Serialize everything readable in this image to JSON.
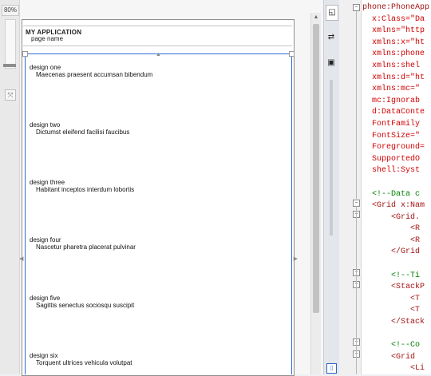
{
  "designer": {
    "zoom": "80%",
    "app_title": "MY APPLICATION",
    "page_name": "page name",
    "items": [
      {
        "title": "design one",
        "subtitle": "Maecenas praesent accumsan bibendum"
      },
      {
        "title": "design two",
        "subtitle": "Dictumst eleifend facilisi faucibus"
      },
      {
        "title": "design three",
        "subtitle": "Habitant inceptos interdum lobortis"
      },
      {
        "title": "design four",
        "subtitle": "Nascetur pharetra placerat pulvinar"
      },
      {
        "title": "design five",
        "subtitle": "Sagittis senectus sociosqu suscipit"
      },
      {
        "title": "design six",
        "subtitle": "Torquent ultrices vehicula volutpat"
      }
    ]
  },
  "xaml": {
    "lines": [
      [
        [
          "phone:PhoneApp",
          "c-tag"
        ]
      ],
      [
        [
          "  x:Class=\"Da",
          "c-attr"
        ]
      ],
      [
        [
          "  xmlns=\"http",
          "c-attr"
        ]
      ],
      [
        [
          "  xmlns:x=\"ht",
          "c-attr"
        ]
      ],
      [
        [
          "  xmlns:phone",
          "c-attr"
        ]
      ],
      [
        [
          "  xmlns:shel",
          "c-attr"
        ]
      ],
      [
        [
          "  xmlns:d=\"ht",
          "c-attr"
        ]
      ],
      [
        [
          "  xmlns:mc=\"",
          "c-attr"
        ]
      ],
      [
        [
          "  mc:Ignorab",
          "c-attr"
        ]
      ],
      [
        [
          "  d:DataConte",
          "c-attr"
        ]
      ],
      [
        [
          "  FontFamily",
          "c-attr"
        ]
      ],
      [
        [
          "  FontSize=\"",
          "c-attr"
        ]
      ],
      [
        [
          "  Foreground=",
          "c-attr"
        ]
      ],
      [
        [
          "  SupportedO",
          "c-attr"
        ]
      ],
      [
        [
          "  shell:Syst",
          "c-attr"
        ]
      ],
      [
        [
          "",
          ""
        ]
      ],
      [
        [
          "  <!--Data c",
          "c-comment"
        ]
      ],
      [
        [
          "  <Grid x:Nam",
          "c-tag"
        ]
      ],
      [
        [
          "      <Grid.",
          "c-tag"
        ]
      ],
      [
        [
          "          <R",
          "c-tag"
        ]
      ],
      [
        [
          "          <R",
          "c-tag"
        ]
      ],
      [
        [
          "      </Grid",
          "c-tag"
        ]
      ],
      [
        [
          "",
          ""
        ]
      ],
      [
        [
          "      <!--Ti",
          "c-comment"
        ]
      ],
      [
        [
          "      <StackP",
          "c-tag"
        ]
      ],
      [
        [
          "          <T",
          "c-tag"
        ]
      ],
      [
        [
          "          <T",
          "c-tag"
        ]
      ],
      [
        [
          "      </Stack",
          "c-tag"
        ]
      ],
      [
        [
          "",
          ""
        ]
      ],
      [
        [
          "      <!--Co",
          "c-comment"
        ]
      ],
      [
        [
          "      <Grid ",
          "c-tag"
        ]
      ],
      [
        [
          "          <Li",
          "c-tag"
        ]
      ]
    ]
  }
}
